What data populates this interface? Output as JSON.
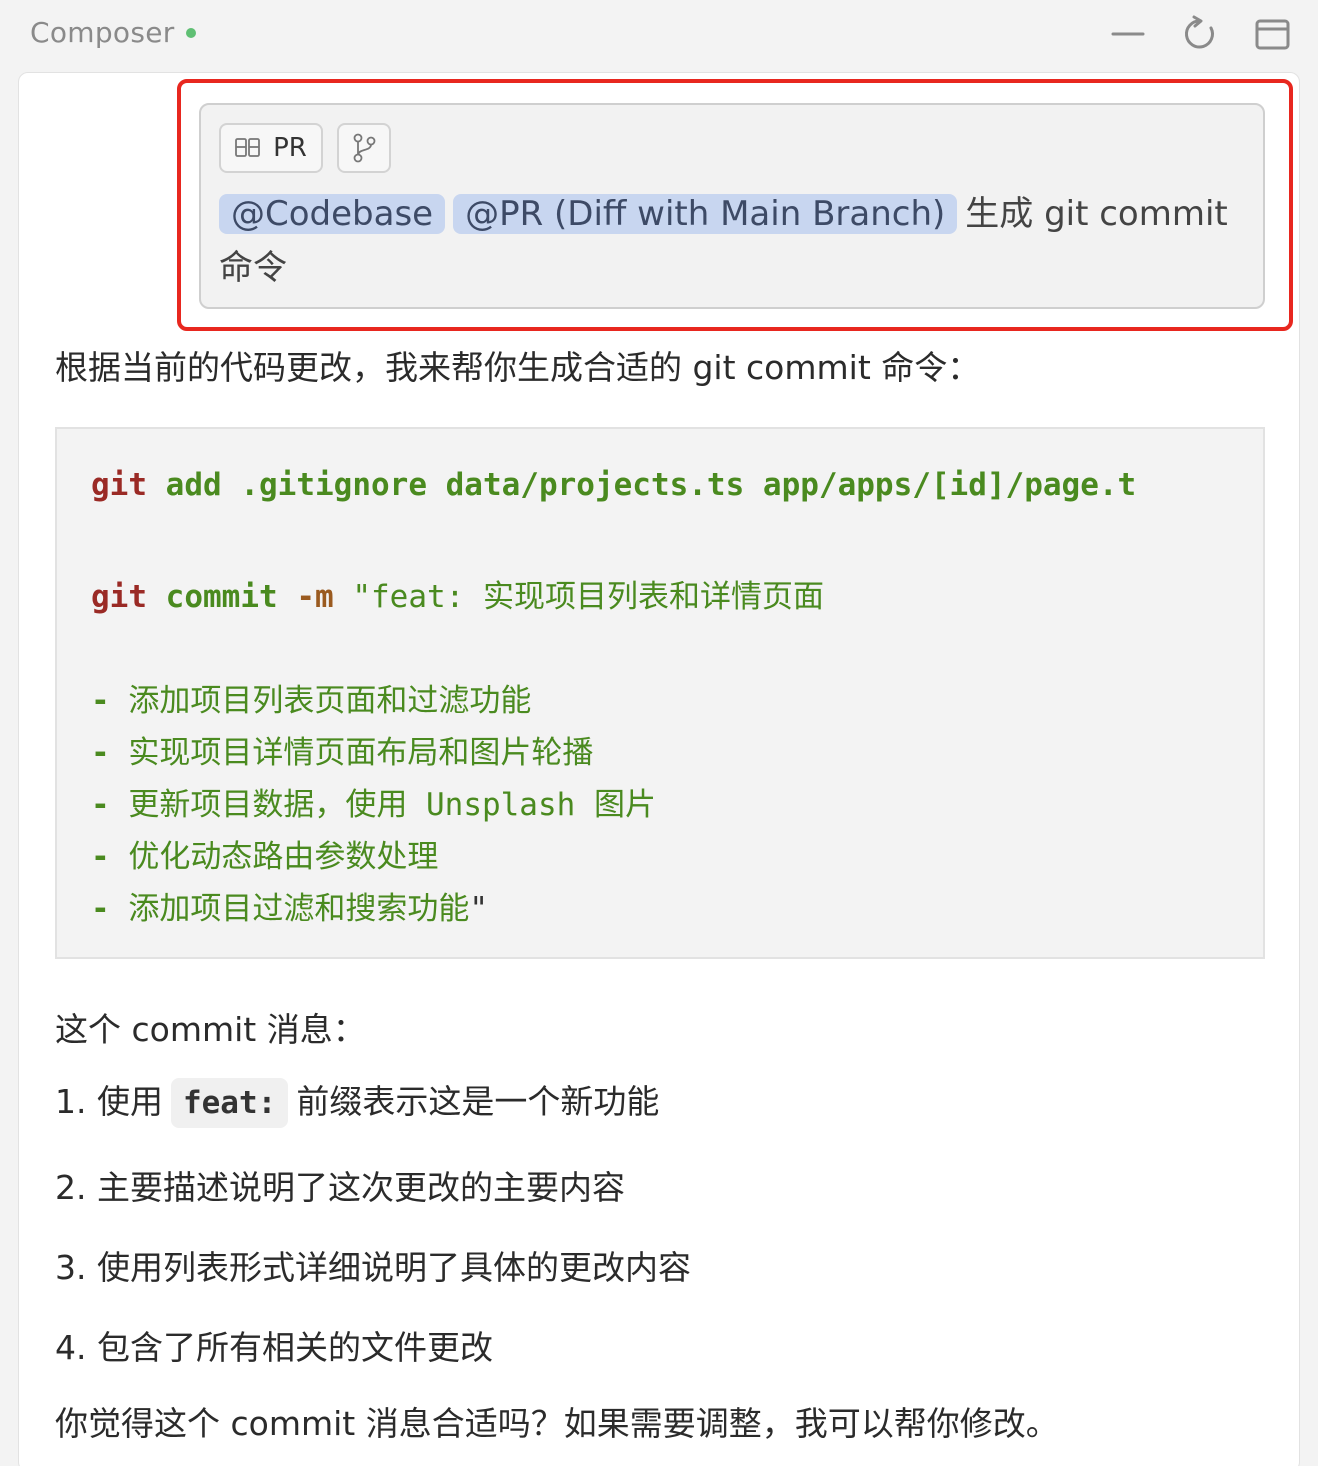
{
  "header": {
    "title": "Composer",
    "status_color": "#5fbf73",
    "icons": [
      "minimize-icon",
      "refresh-icon",
      "layout-icon"
    ]
  },
  "prompt": {
    "chip_pr_label": "PR",
    "mentions": [
      "@Codebase",
      "@PR (Diff with Main Branch)"
    ],
    "text": "生成 git commit 命令"
  },
  "response": {
    "intro": "根据当前的代码更改，我来帮你生成合适的 git commit 命令：",
    "code": {
      "line1": {
        "cmd": "git",
        "sub": "add",
        "args": ".gitignore data/projects.ts app/apps/[id]/page.t"
      },
      "line2": {
        "cmd": "git",
        "sub": "commit",
        "flag": "-m",
        "msg": "\"feat: 实现项目列表和详情页面"
      },
      "bullets": [
        "添加项目列表页面和过滤功能",
        "实现项目详情页面布局和图片轮播",
        "更新项目数据，使用 Unsplash 图片",
        "优化动态路由参数处理",
        "添加项目过滤和搜索功能"
      ],
      "closing_quote": "\""
    },
    "explain_title": "这个 commit 消息：",
    "points": {
      "p1_prefix": "1. 使用",
      "p1_code": "feat:",
      "p1_suffix": "前缀表示这是一个新功能",
      "p2": "2. 主要描述说明了这次更改的主要内容",
      "p3": "3. 使用列表形式详细说明了具体的更改内容",
      "p4": "4. 包含了所有相关的文件更改"
    },
    "closing": "你觉得这个 commit 消息合适吗？如果需要调整，我可以帮你修改。"
  }
}
